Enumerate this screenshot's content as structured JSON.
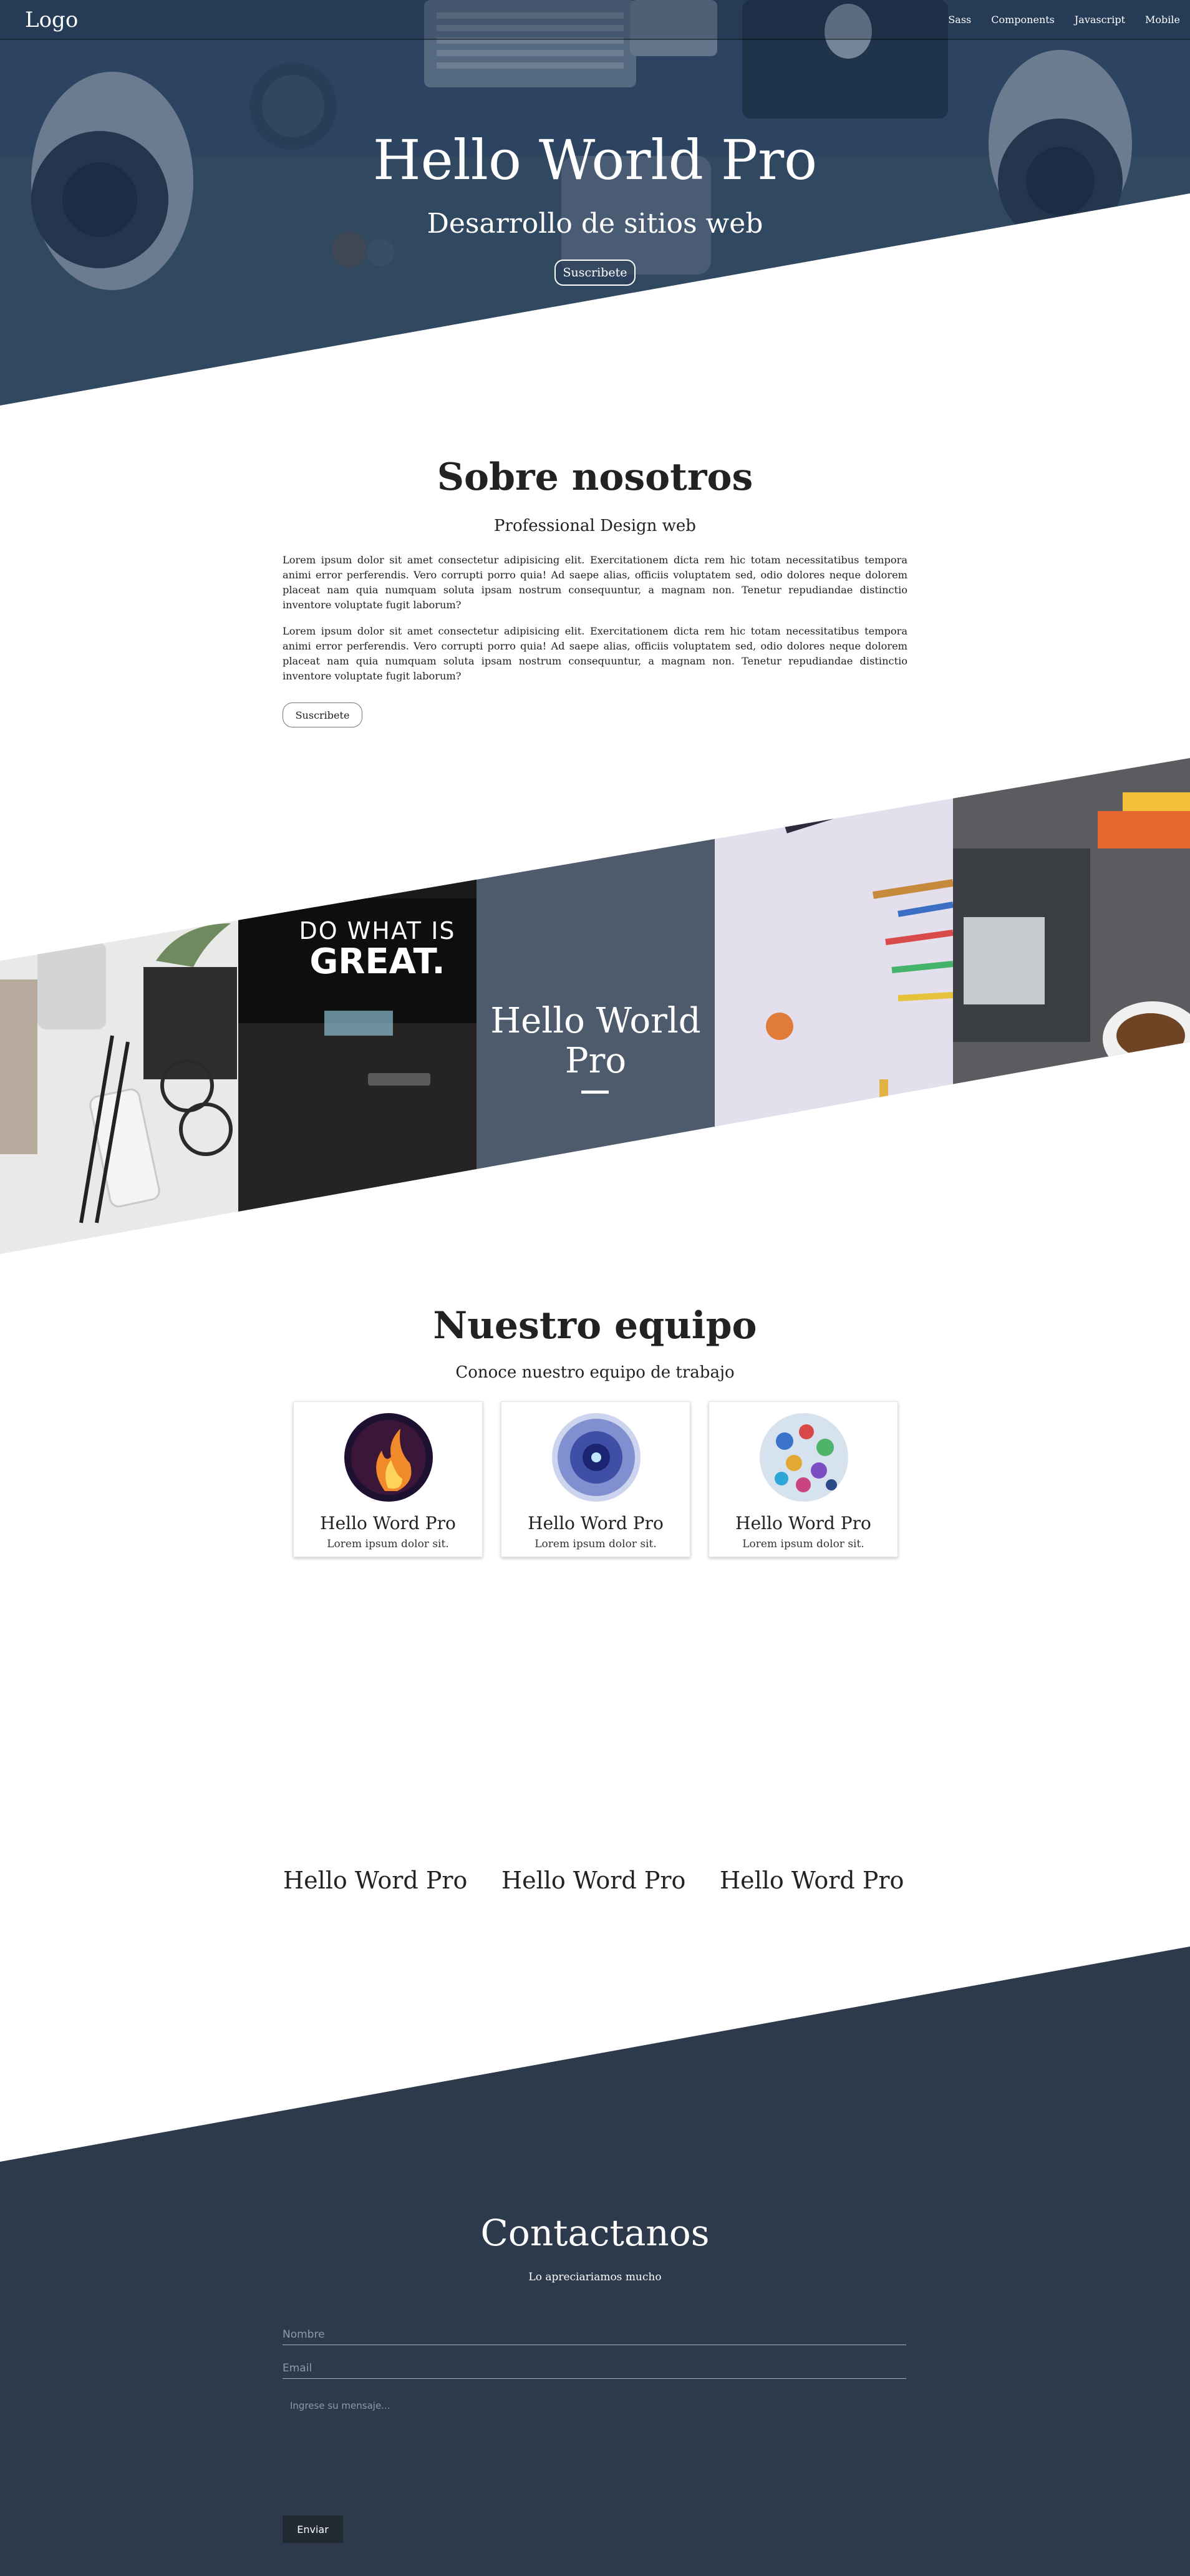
{
  "navbar": {
    "logo": "Logo",
    "links": [
      "Sass",
      "Components",
      "Javascript",
      "Mobile"
    ]
  },
  "hero": {
    "title": "Hello World Pro",
    "subtitle": "Desarrollo de sitios web",
    "button": "Suscribete"
  },
  "about": {
    "title": "Sobre nosotros",
    "subtitle": "Professional Design web",
    "paragraphs": [
      "Lorem ipsum dolor sit amet consectetur adipisicing elit. Exercitationem dicta rem hic totam necessitatibus tempora animi error perferendis. Vero corrupti porro quia! Ad saepe alias, officiis voluptatem sed, odio dolores neque dolorem placeat nam quia numquam soluta ipsam nostrum consequuntur, a magnam non. Tenetur repudiandae distinctio inventore voluptate fugit laborum?",
      "Lorem ipsum dolor sit amet consectetur adipisicing elit. Exercitationem dicta rem hic totam necessitatibus tempora animi error perferendis. Vero corrupti porro quia! Ad saepe alias, officiis voluptatem sed, odio dolores neque dolorem placeat nam quia numquam soluta ipsam nostrum consequuntur, a magnam non. Tenetur repudiandae distinctio inventore voluptate fugit laborum?"
    ],
    "button": "Suscribete"
  },
  "gallery": {
    "title": "Hello World Pro",
    "poster_line1": "DO WHAT IS",
    "poster_line2": "GREAT."
  },
  "team": {
    "title": "Nuestro equipo",
    "subtitle": "Conoce nuestro equipo de trabajo",
    "cards": [
      {
        "title": "Hello Word Pro",
        "text": "Lorem ipsum dolor sit."
      },
      {
        "title": "Hello Word Pro",
        "text": "Lorem ipsum dolor sit."
      },
      {
        "title": "Hello Word Pro",
        "text": "Lorem ipsum dolor sit."
      }
    ],
    "names": [
      "Hello Word Pro",
      "Hello Word Pro",
      "Hello Word Pro"
    ]
  },
  "contact": {
    "title": "Contactanos",
    "subtitle": "Lo apreciariamos mucho",
    "name_placeholder": "Nombre",
    "email_placeholder": "Email",
    "message_placeholder": "Ingrese su mensaje...",
    "send_button": "Enviar"
  },
  "colors": {
    "hero_overlay": "#1e3755",
    "gallery_panel": "#4d5b6c",
    "contact_bg": "#2d3a4c",
    "send_button": "#222a33"
  }
}
